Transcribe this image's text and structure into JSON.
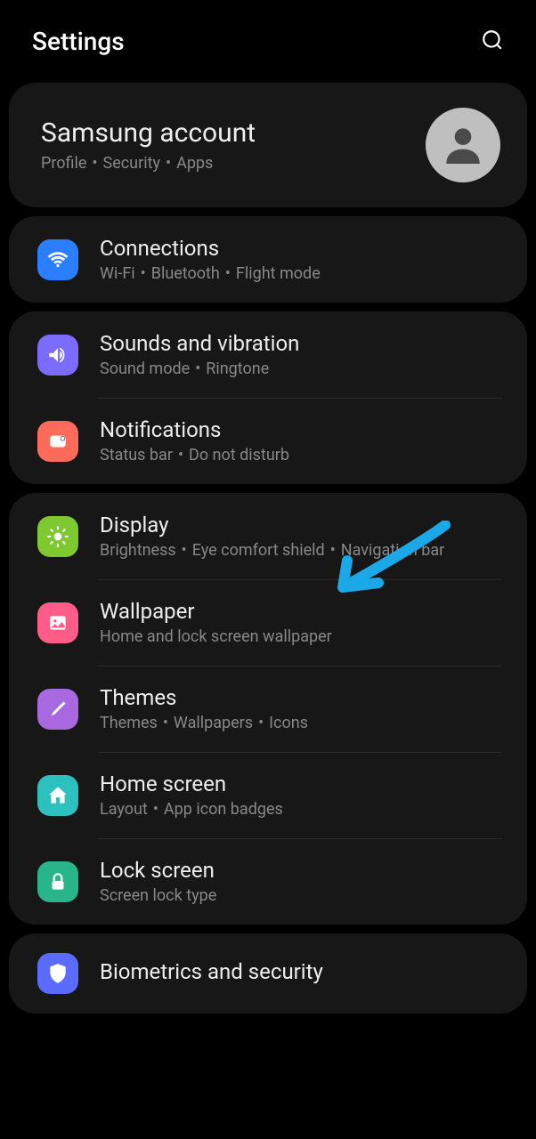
{
  "header": {
    "title": "Settings"
  },
  "account": {
    "title": "Samsung account",
    "subtitle_parts": [
      "Profile",
      "Security",
      "Apps"
    ]
  },
  "groups": [
    {
      "items": [
        {
          "id": "connections",
          "title": "Connections",
          "subtitle_parts": [
            "Wi-Fi",
            "Bluetooth",
            "Flight mode"
          ],
          "icon": "wifi-icon",
          "icon_class": "icon-connections"
        }
      ]
    },
    {
      "items": [
        {
          "id": "sounds",
          "title": "Sounds and vibration",
          "subtitle_parts": [
            "Sound mode",
            "Ringtone"
          ],
          "icon": "speaker-icon",
          "icon_class": "icon-sounds"
        },
        {
          "id": "notifications",
          "title": "Notifications",
          "subtitle_parts": [
            "Status bar",
            "Do not disturb"
          ],
          "icon": "notification-icon",
          "icon_class": "icon-notifications"
        }
      ]
    },
    {
      "items": [
        {
          "id": "display",
          "title": "Display",
          "subtitle_parts": [
            "Brightness",
            "Eye comfort shield",
            "Navigation bar"
          ],
          "icon": "sun-icon",
          "icon_class": "icon-display"
        },
        {
          "id": "wallpaper",
          "title": "Wallpaper",
          "subtitle_parts": [
            "Home and lock screen wallpaper"
          ],
          "icon": "picture-icon",
          "icon_class": "icon-wallpaper"
        },
        {
          "id": "themes",
          "title": "Themes",
          "subtitle_parts": [
            "Themes",
            "Wallpapers",
            "Icons"
          ],
          "icon": "brush-icon",
          "icon_class": "icon-themes"
        },
        {
          "id": "home",
          "title": "Home screen",
          "subtitle_parts": [
            "Layout",
            "App icon badges"
          ],
          "icon": "home-icon",
          "icon_class": "icon-home"
        },
        {
          "id": "lock",
          "title": "Lock screen",
          "subtitle_parts": [
            "Screen lock type"
          ],
          "icon": "lock-icon",
          "icon_class": "icon-lock"
        }
      ]
    },
    {
      "items": [
        {
          "id": "biometrics",
          "title": "Biometrics and security",
          "subtitle_parts": [],
          "icon": "shield-icon",
          "icon_class": "icon-biometrics"
        }
      ]
    }
  ]
}
